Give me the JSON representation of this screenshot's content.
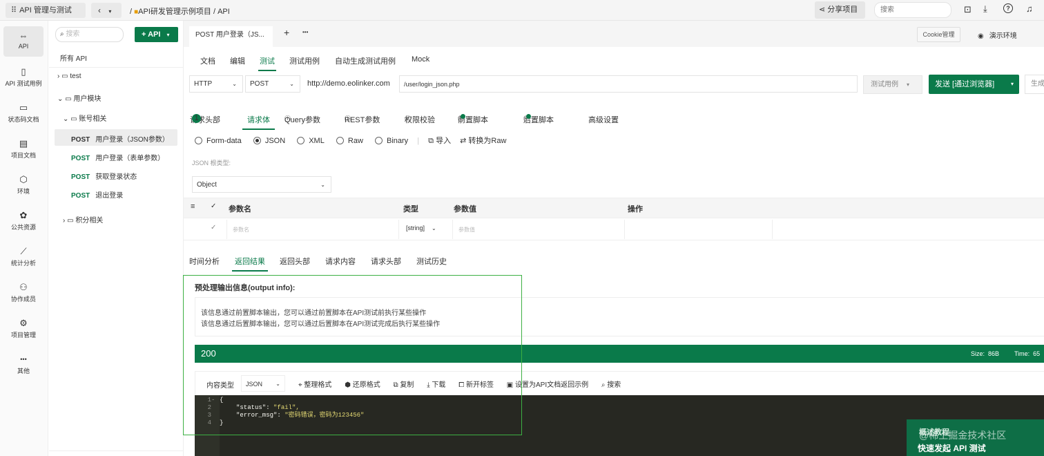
{
  "topbar": {
    "app_title": "API 管理与测试",
    "breadcrumb_sep": "/",
    "breadcrumb_project": "API研发管理示例项目",
    "breadcrumb_page": "API",
    "share_label": "分享项目",
    "search_placeholder": "搜索"
  },
  "leftnav": [
    {
      "label": "API",
      "icon": "⇔"
    },
    {
      "label": "API 测试用例",
      "icon": "▯"
    },
    {
      "label": "状态码文档",
      "icon": "▭"
    },
    {
      "label": "项目文档",
      "icon": "▤"
    },
    {
      "label": "环境",
      "icon": "⬡"
    },
    {
      "label": "公共资源",
      "icon": "✿"
    },
    {
      "label": "统计分析",
      "icon": "⟋"
    },
    {
      "label": "协作成员",
      "icon": "⚇"
    },
    {
      "label": "项目管理",
      "icon": "⚙"
    },
    {
      "label": "其他",
      "icon": "•••"
    }
  ],
  "tree": {
    "search_placeholder": "搜索",
    "add_label": "+ API",
    "all_label": "所有 API",
    "folder_test": "test",
    "folder_user": "用户模块",
    "folder_account": "账号相关",
    "items": [
      {
        "method": "POST",
        "name": "用户登录（JSON参数）"
      },
      {
        "method": "POST",
        "name": "用户登录（表单参数）"
      },
      {
        "method": "POST",
        "name": "获取登录状态"
      },
      {
        "method": "POST",
        "name": "退出登录"
      }
    ],
    "folder_points": "积分相关"
  },
  "doc_tab": {
    "method": "POST",
    "title": "用户登录（JS...",
    "add": "+",
    "more": "•••"
  },
  "env": {
    "cookie_label": "Cookie管理",
    "env_label": "演示环境"
  },
  "subtabs": [
    "文档",
    "编辑",
    "测试",
    "测试用例",
    "自动生成测试用例",
    "Mock"
  ],
  "request": {
    "protocol": "HTTP",
    "method": "POST",
    "base_url": "http://demo.eolinker.com",
    "path": "/user/login_json.php",
    "testcase_label": "测试用例",
    "send_label": "发送 [通过浏览器]",
    "gen_label": "生成"
  },
  "req_tabs": {
    "headers": "请求头部",
    "headers_count": "1",
    "body": "请求体",
    "query": "Query参数",
    "rest": "REST参数",
    "auth": "权限校验",
    "pre": "前置脚本",
    "post": "后置脚本",
    "advanced": "高级设置"
  },
  "body_types": [
    "Form-data",
    "JSON",
    "XML",
    "Raw",
    "Binary"
  ],
  "import_label": "导入",
  "convert_label": "转换为Raw",
  "json_root_label": "JSON 根类型:",
  "json_root_value": "Object",
  "table": {
    "headers": [
      "参数名",
      "类型",
      "参数值",
      "操作"
    ],
    "row": {
      "name_placeholder": "参数名",
      "type": "[string]",
      "value_placeholder": "参数值"
    }
  },
  "resp_tabs": [
    "时间分析",
    "返回结果",
    "返回头部",
    "请求内容",
    "请求头部",
    "测试历史"
  ],
  "output": {
    "title": "预处理输出信息(output info):",
    "line1": "该信息通过前置脚本输出，您可以通过前置脚本在API测试前执行某些操作",
    "line2": "该信息通过后置脚本输出，您可以通过后置脚本在API测试完成后执行某些操作"
  },
  "status": {
    "code": "200",
    "size": "Size:  86B",
    "time": "Time:  65"
  },
  "content_toolbar": {
    "type_label": "内容类型",
    "type_value": "JSON",
    "format": "整理格式",
    "restore": "还原格式",
    "copy": "复制",
    "download": "下载",
    "newtab": "新开标签",
    "set_example": "设置为API文档返回示例",
    "search": "搜索"
  },
  "code_lines": [
    {
      "n": "1",
      "text": "{"
    },
    {
      "n": "2",
      "key": "\"status\"",
      "val": "\"fail\","
    },
    {
      "n": "3",
      "key": "\"error_msg\"",
      "val": "\"密码错误，密码为123456\""
    },
    {
      "n": "4",
      "text": "}"
    }
  ],
  "promo": {
    "line1": "概述教程",
    "line2": "快速发起 API 测试",
    "watermark": "@稀土掘金技术社区"
  },
  "colors": {
    "accent": "#0a7a4a",
    "highlight_box": "#3cb043"
  }
}
